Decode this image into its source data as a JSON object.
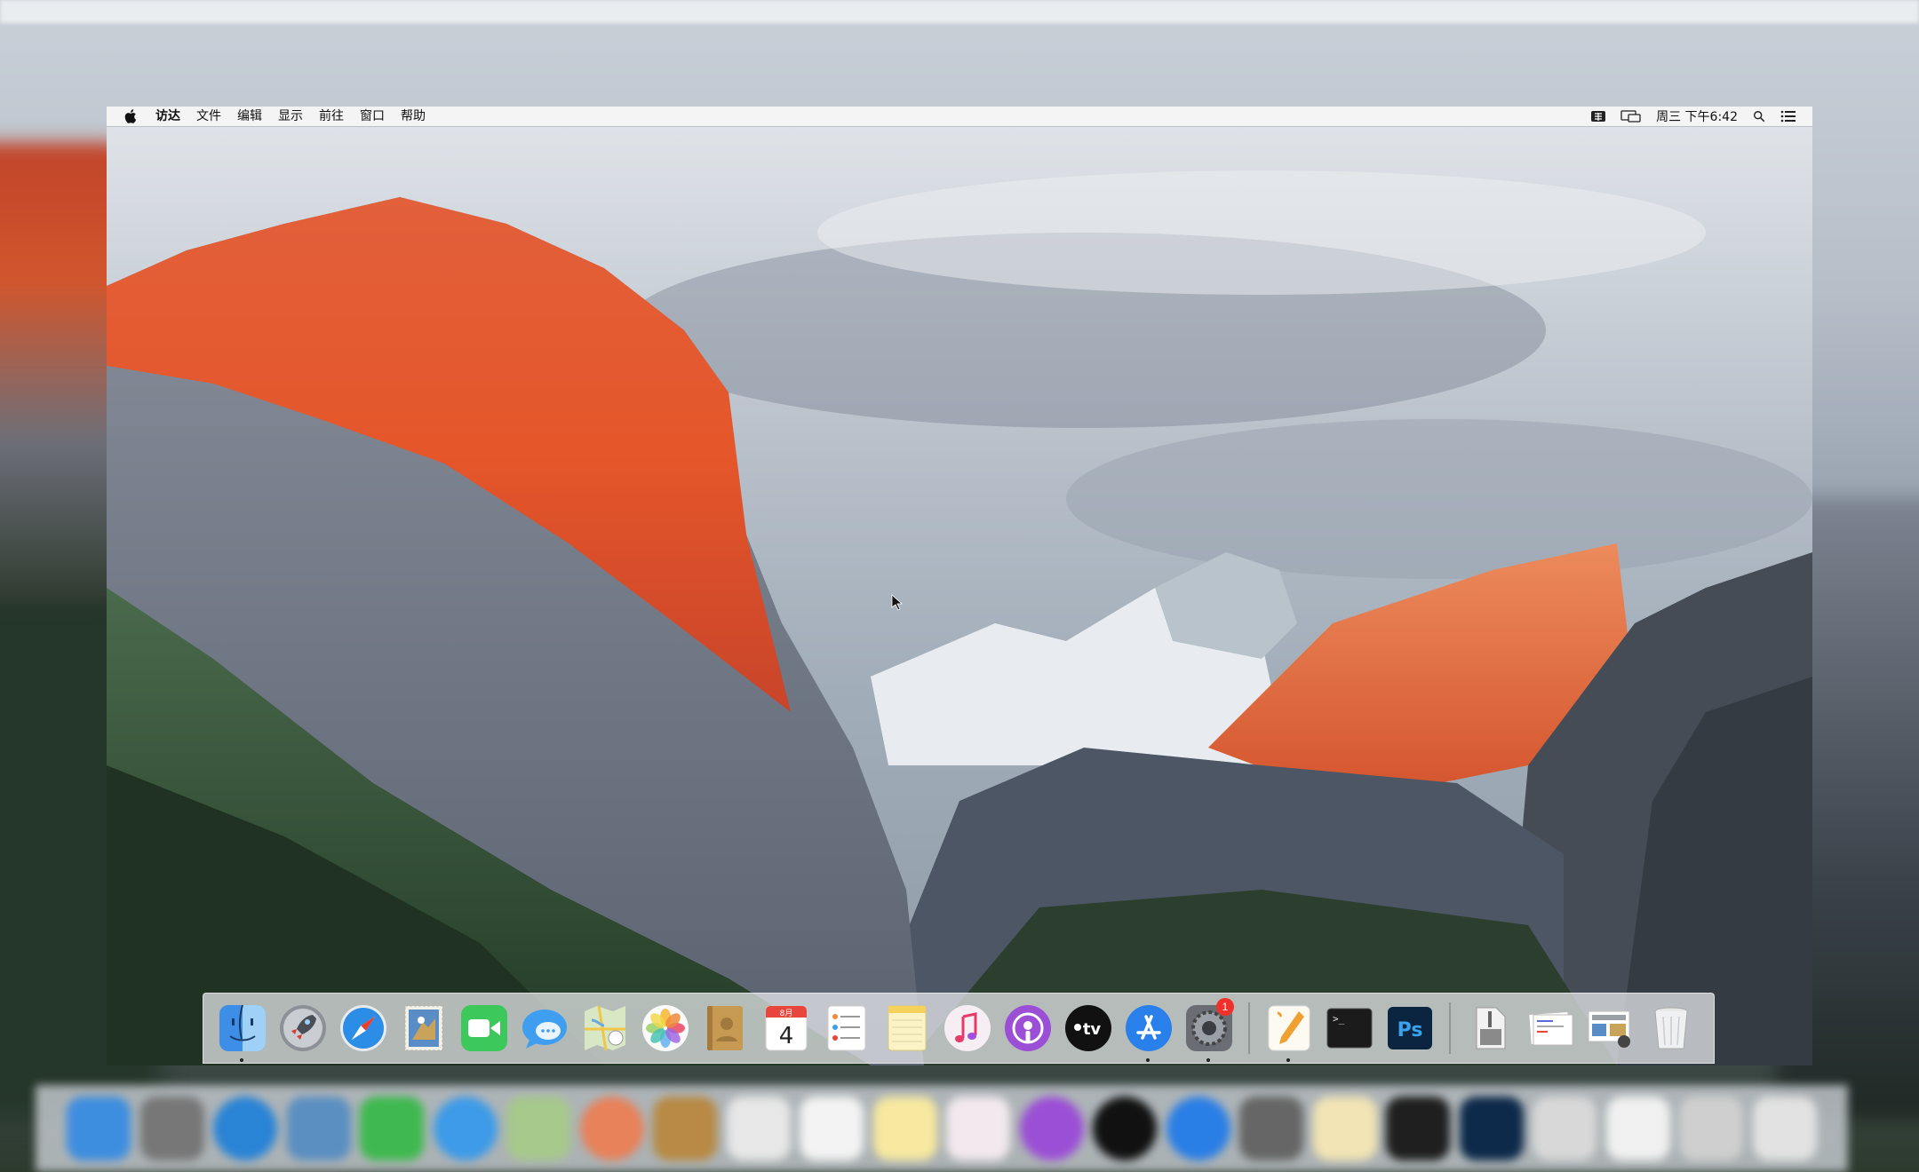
{
  "menubar": {
    "app_name": "访达",
    "items": [
      "文件",
      "编辑",
      "显示",
      "前往",
      "窗口",
      "帮助"
    ],
    "clock": "周三 下午6:42",
    "right_icons": [
      "input-method-icon",
      "display-mirroring-icon",
      "spotlight-icon",
      "notification-center-icon"
    ]
  },
  "desktop": {
    "wallpaper": "El Capitan",
    "colors": {
      "sky": "#c3c9d1",
      "cliff_glow": "#e0502a",
      "rock": "#6f7682",
      "forest": "#2f4a33"
    }
  },
  "dock": {
    "apps": [
      {
        "name": "finder",
        "icon": "finder-icon",
        "running": true
      },
      {
        "name": "launchpad",
        "icon": "rocket-icon",
        "running": false
      },
      {
        "name": "safari",
        "icon": "compass-icon",
        "running": false
      },
      {
        "name": "mail",
        "icon": "eagle-stamp-icon",
        "running": false
      },
      {
        "name": "facetime",
        "icon": "video-camera-icon",
        "running": false
      },
      {
        "name": "messages",
        "icon": "chat-bubble-icon",
        "running": false
      },
      {
        "name": "maps",
        "icon": "map-icon",
        "running": false
      },
      {
        "name": "photos",
        "icon": "flower-icon",
        "running": false
      },
      {
        "name": "contacts",
        "icon": "address-book-icon",
        "running": false
      },
      {
        "name": "calendar",
        "icon": "calendar-icon",
        "running": false
      },
      {
        "name": "reminders",
        "icon": "checklist-icon",
        "running": false
      },
      {
        "name": "notes",
        "icon": "notepad-icon",
        "running": false
      },
      {
        "name": "music",
        "icon": "music-note-icon",
        "running": false
      },
      {
        "name": "podcasts",
        "icon": "podcast-icon",
        "running": false
      },
      {
        "name": "tv",
        "icon": "apple-tv-icon",
        "running": false
      },
      {
        "name": "app-store",
        "icon": "app-store-icon",
        "running": true
      },
      {
        "name": "system-preferences",
        "icon": "gear-icon",
        "running": true,
        "badge": "1"
      }
    ],
    "extra_apps": [
      {
        "name": "pages",
        "icon": "pen-icon",
        "running": true
      },
      {
        "name": "terminal",
        "icon": "terminal-icon",
        "running": false
      },
      {
        "name": "photoshop",
        "icon": "photoshop-icon",
        "running": false
      }
    ],
    "calendar_month": "8月",
    "calendar_day": "4",
    "tv_label": "tv",
    "photoshop_label": "Ps",
    "terminal_prompt": ">_",
    "stacks": [
      {
        "name": "archive-utility",
        "icon": "archive-icon"
      },
      {
        "name": "document-stack",
        "icon": "document-stack-icon"
      },
      {
        "name": "screenshot-stack",
        "icon": "screenshots-icon"
      },
      {
        "name": "trash",
        "icon": "trash-icon"
      }
    ]
  }
}
